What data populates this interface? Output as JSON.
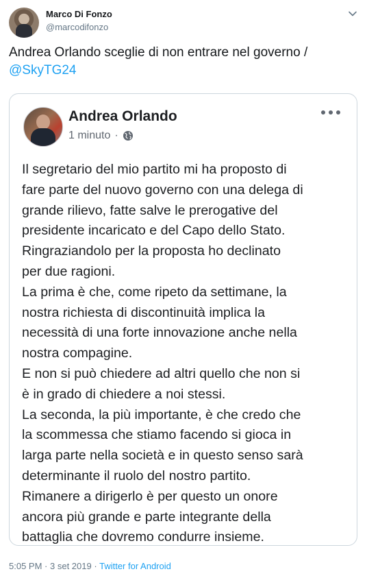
{
  "tweet": {
    "author_name": "Marco Di Fonzo",
    "author_handle": "@marcodifonzo",
    "text": "Andrea Orlando sceglie di non entrare nel governo /",
    "mention": "@SkyTG24",
    "time": "5:05 PM",
    "date": "3 set 2019",
    "separator": "·",
    "source": "Twitter for Android"
  },
  "embed": {
    "author_name": "Andrea Orlando",
    "timestamp": "1 minuto",
    "privacy_separator": "·",
    "privacy_icon": "globe-icon",
    "menu_icon": "more-options-icon",
    "body_lines": [
      "Il segretario del mio partito mi ha proposto di",
      "fare parte del nuovo governo con una delega di",
      "grande rilievo, fatte salve le prerogative del",
      "presidente incaricato e del Capo dello Stato.",
      "Ringraziandolo per la proposta ho declinato",
      "per due ragioni.",
      "La prima è che, come ripeto da settimane, la",
      "nostra richiesta di discontinuità implica la",
      "necessità di una forte innovazione anche nella",
      "nostra compagine.",
      "E non si può chiedere ad altri quello che non si",
      "è in grado di chiedere a noi stessi.",
      "La seconda, la più importante, è che credo che",
      "la scommessa che stiamo facendo si gioca in",
      "larga parte nella società e in questo senso sarà",
      "determinante il ruolo del nostro partito.",
      "Rimanere a dirigerlo è per questo un onore",
      "ancora più grande e parte integrante della",
      "battaglia che dovremo condurre insieme."
    ]
  },
  "colors": {
    "link": "#1da1f2",
    "secondary_text": "#657786",
    "border": "#ccd6dd"
  }
}
